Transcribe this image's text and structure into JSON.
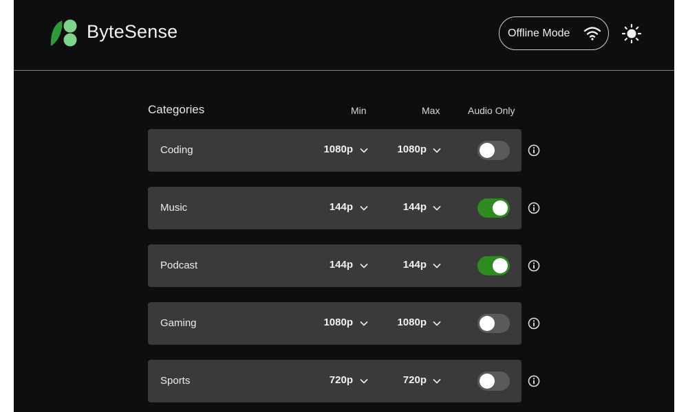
{
  "app": {
    "brand": "ByteSense"
  },
  "header": {
    "offline_label": "Offline Mode",
    "wifi_icon": "wifi-icon",
    "theme_icon": "sun-icon"
  },
  "columns": {
    "categories": "Categories",
    "min": "Min",
    "max": "Max",
    "audio_only": "Audio Only"
  },
  "rows": [
    {
      "name": "Coding",
      "min": "1080p",
      "max": "1080p",
      "audio_only": false
    },
    {
      "name": "Music",
      "min": "144p",
      "max": "144p",
      "audio_only": true
    },
    {
      "name": "Podcast",
      "min": "144p",
      "max": "144p",
      "audio_only": true
    },
    {
      "name": "Gaming",
      "min": "1080p",
      "max": "1080p",
      "audio_only": false
    },
    {
      "name": "Sports",
      "min": "720p",
      "max": "720p",
      "audio_only": false
    }
  ],
  "colors": {
    "background": "#0e0e0e",
    "row": "#3a3a3a",
    "toggle_on": "#2e8b1f",
    "toggle_off": "#5a5a5a",
    "logo_green": "#4caf50"
  }
}
